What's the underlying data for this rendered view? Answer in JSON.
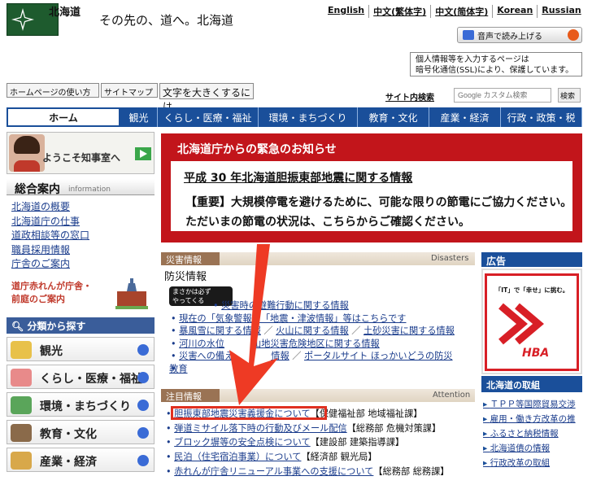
{
  "header": {
    "site_name": "北海道",
    "tagline": "その先の、道へ。北海道",
    "languages": [
      "English",
      "中文(繁体字)",
      "中文(简体字)",
      "Korean",
      "Russian"
    ],
    "voice_button": "音声で読み上げる",
    "ssl_notice_l1": "個人情報等を入力するページは",
    "ssl_notice_l2": "暗号化通信(SSL)により、保護しています。"
  },
  "utility": {
    "help": "ホームページの使い方",
    "sitemap": "サイトマップ",
    "text_size": "文字を大きくするには",
    "search_label": "サイト内検索",
    "search_placeholder": "Google カスタム検索",
    "search_button": "検索"
  },
  "nav": [
    "ホーム",
    "観光",
    "くらし・医療・福祉",
    "環境・まちづくり",
    "教育・文化",
    "産業・経済",
    "行政・政策・税"
  ],
  "left": {
    "welcome": "ようこそ知事室へ",
    "sogo_title": "総合案内",
    "sogo_sub": "information",
    "sogo_links": [
      "北海道の概要",
      "北海道庁の仕事",
      "道政相談等の窓口",
      "職員採用情報",
      "庁舎のご案内"
    ],
    "banner_l1": "道庁赤れんが庁舎・",
    "banner_l2": "前庭のご案内",
    "bunrui": "分類から探す",
    "categories": [
      "観光",
      "くらし・医療・福祉",
      "環境・まちづくり",
      "教育・文化",
      "産業・経済"
    ]
  },
  "emergency": {
    "title": "北海道庁からの緊急のお知らせ",
    "line1": "平成 30 年北海道胆振東部地震に関する情報",
    "line2": "【重要】大規模停電を避けるために、可能な限りの節電にご協力ください。",
    "line3": "ただいまの節電の状況は、こちらからご確認ください。"
  },
  "disaster": {
    "tag": "災害情報",
    "en": "Disasters",
    "sub": "防災情報",
    "masaka_l1": "まさかは必ず",
    "masaka_l2": "やってくる",
    "items": [
      [
        "災害時の避難行動に関する情報"
      ],
      [
        "現在の「気象警報」、「地震・津波情報」等はこちらです"
      ],
      [
        "暴風雪に関する情報",
        "火山に関する情報",
        "土砂災害に関する情報"
      ],
      [
        "河川の水位",
        "山地災害危険地区に関する情報"
      ],
      [
        "災害への備え",
        "情報",
        "ポータルサイト ほっかいどうの防災"
      ],
      [
        "教育"
      ]
    ]
  },
  "attention": {
    "tag": "注目情報",
    "en": "Attention",
    "items": [
      {
        "link": "胆振東部地震災害義援金について",
        "dept": "【保健福祉部 地域福祉課】"
      },
      {
        "link": "弾道ミサイル落下時の行動及びメール配信",
        "dept": "【総務部 危機対策課】"
      },
      {
        "link": "ブロック塀等の安全点検について",
        "dept": "【建設部 建築指導課】"
      },
      {
        "link": "民泊（住宅宿泊事業）について",
        "dept": "【経済部 観光局】"
      },
      {
        "link": "赤れんが庁舎リニューアル事業への支援について",
        "dept": "【総務部 総務課】"
      }
    ]
  },
  "right": {
    "ad_head": "広告",
    "ad_text": "「IT」で「幸せ」に挑む。",
    "ad_logo": "HBA",
    "tori_head": "北海道の取組",
    "tori_items": [
      "ＴＰＰ等国際貿易交渉",
      "雇用・働き方改革の推",
      "ふるさと納税情報",
      "北海道債の情報",
      "行政改革の取組"
    ]
  },
  "colors": {
    "nav_blue": "#1a4f9a",
    "emergency_red": "#c2151b",
    "link_blue": "#1a3c8c",
    "highlight_red": "#e03020"
  }
}
